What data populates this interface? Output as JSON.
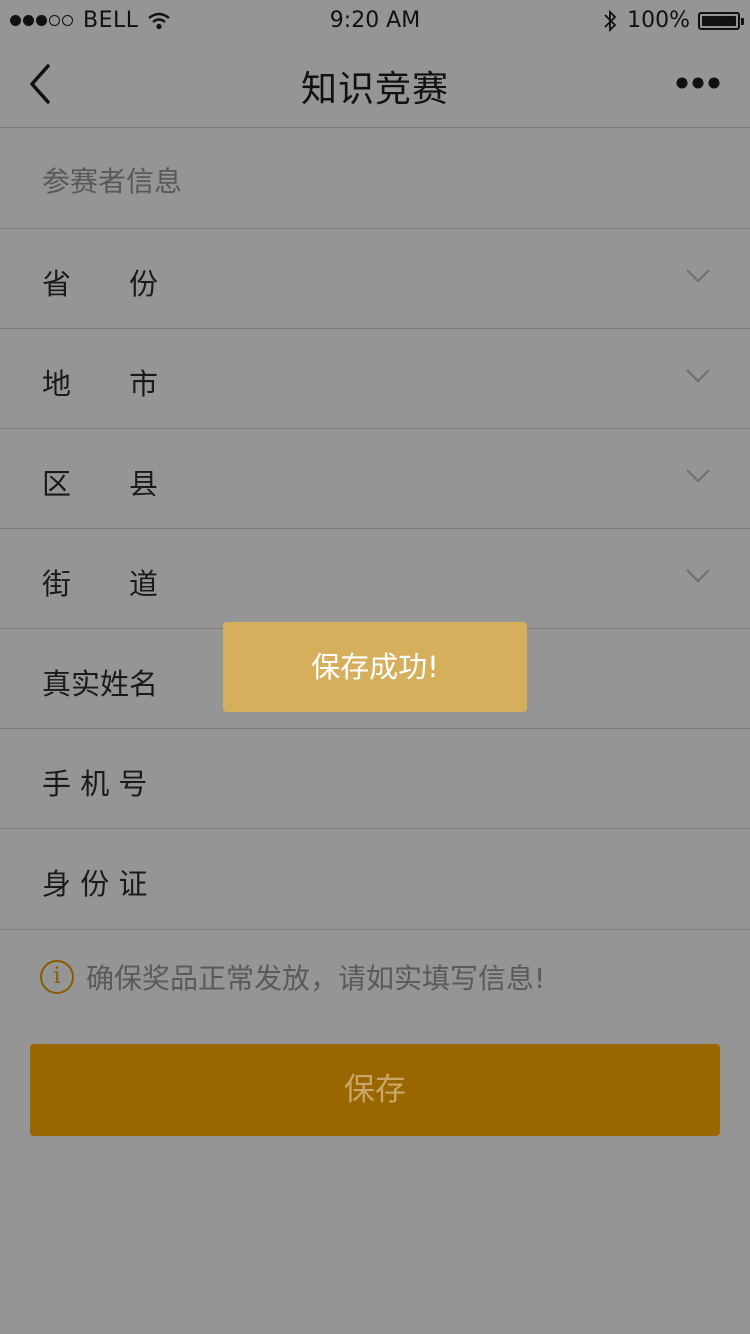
{
  "status_bar": {
    "carrier": "BELL",
    "time": "9:20 AM",
    "bluetooth": "bluetooth-icon",
    "battery_percent": "100%"
  },
  "nav": {
    "title": "知识竞赛",
    "back_icon": "chevron-left-icon",
    "more_icon": "more-dots-icon"
  },
  "form": {
    "section_label": "参赛者信息",
    "rows": [
      {
        "label": "省　　份",
        "has_dropdown": true
      },
      {
        "label": "地　　市",
        "has_dropdown": true
      },
      {
        "label": "区　　县",
        "has_dropdown": true
      },
      {
        "label": "街　　道",
        "has_dropdown": true
      },
      {
        "label": "真实姓名",
        "has_dropdown": false
      },
      {
        "label": "手 机 号",
        "has_dropdown": false
      },
      {
        "label": "身 份 证",
        "has_dropdown": false
      }
    ]
  },
  "notice": {
    "icon": "info-icon",
    "text": "确保奖品正常发放，请如实填写信息!"
  },
  "save_button": {
    "label": "保存"
  },
  "toast": {
    "message": "保存成功!"
  },
  "colors": {
    "overlay_bg": "#959595",
    "accent": "#9a6600",
    "toast_bg": "#d6af5c"
  }
}
